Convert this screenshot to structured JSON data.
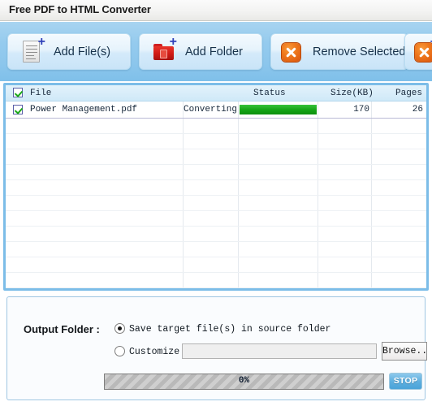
{
  "window": {
    "title": "Free PDF to HTML Converter"
  },
  "toolbar": {
    "buttons": [
      {
        "label": "Add File(s)",
        "icon": "document-plus-icon"
      },
      {
        "label": "Add Folder",
        "icon": "folder-plus-icon"
      },
      {
        "label": "Remove Selected",
        "icon": "remove-x-icon"
      },
      {
        "label": "",
        "icon": "remove-all-x-icon"
      }
    ]
  },
  "file_list": {
    "columns": {
      "file": "File",
      "status": "Status",
      "size": "Size(KB)",
      "pages": "Pages"
    },
    "select_all_checked": true,
    "rows": [
      {
        "checked": true,
        "file": "Power Management.pdf",
        "status": "Converting",
        "progress_percent": 100,
        "size": "170",
        "pages": "26"
      }
    ]
  },
  "output": {
    "label": "Output Folder :",
    "option_source": "Save target file(s) in source folder",
    "option_customize": "Customize",
    "selected_option": "source",
    "path_value": "",
    "path_placeholder": "",
    "browse_label": "Browse..",
    "progress_label": "0%",
    "progress_percent": 0,
    "stop_label": "STOP"
  },
  "colors": {
    "toolbar_blue": "#8cc6ec",
    "panel_border_blue": "#7cbde8",
    "progress_green": "#14a315",
    "accent_red": "#cf1a15",
    "accent_orange": "#ef7a1e",
    "stop_blue": "#5fb0e0"
  }
}
